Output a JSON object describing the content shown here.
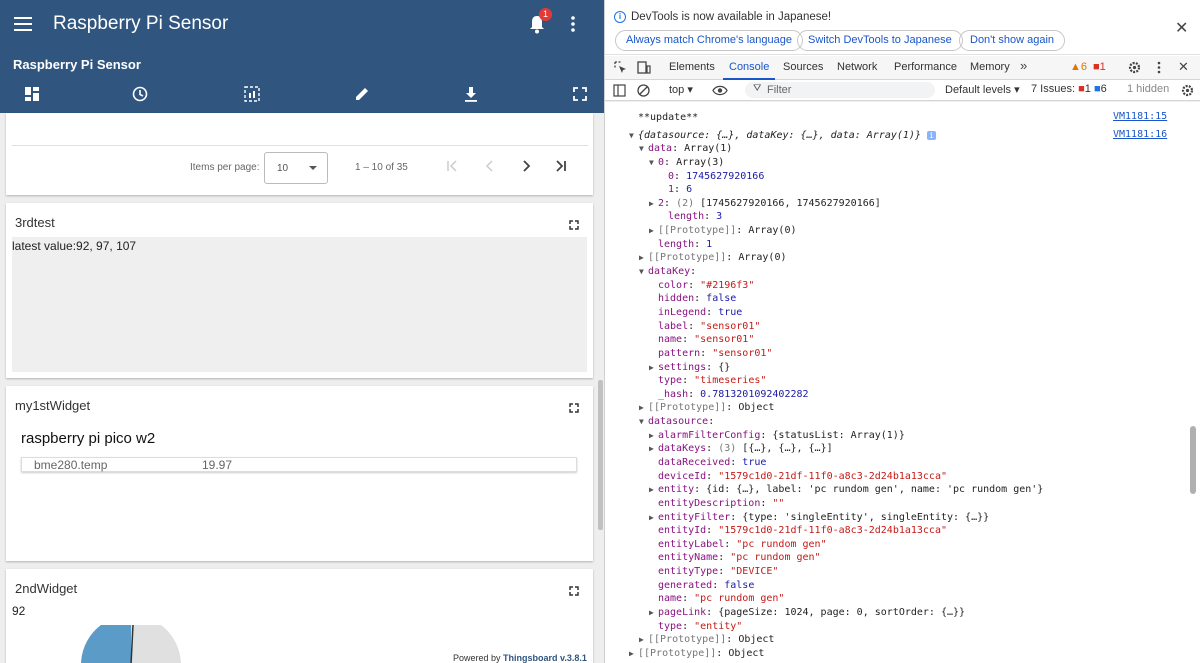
{
  "app": {
    "title": "Raspberry Pi Sensor",
    "notification_count": "1",
    "dashboard_title": "Raspberry Pi Sensor"
  },
  "toolbar_icons": [
    "dashboard-layout-icon",
    "history-icon",
    "widget-select-icon",
    "edit-icon",
    "download-icon",
    "fullscreen-icon"
  ],
  "pagination": {
    "items_per_page_label": "Items per page:",
    "items_per_page_value": "10",
    "range": "1 – 10 of 35"
  },
  "widgets": {
    "third": {
      "title": "3rdtest",
      "value_text": "latest value:92, 97, 107"
    },
    "first": {
      "title": "my1stWidget",
      "heading": "raspberry pi pico w2",
      "key": "bme280.temp",
      "value": "19.97"
    },
    "second": {
      "title": "2ndWidget",
      "value": "92"
    }
  },
  "footer": {
    "powered_by": "Powered by",
    "brand": "Thingsboard v.3.8.1"
  },
  "devtools": {
    "info_text": "DevTools is now available in Japanese!",
    "buttons": [
      "Always match Chrome's language",
      "Switch DevTools to Japanese",
      "Don't show again"
    ],
    "tabs": [
      "Elements",
      "Console",
      "Sources",
      "Network",
      "Performance",
      "Memory"
    ],
    "active_tab": "Console",
    "warn_count": "6",
    "error_count": "1",
    "context": "top",
    "filter_placeholder": "Filter",
    "levels": "Default levels",
    "issues_label": "7 Issues:",
    "issues_err": "1",
    "issues_info": "6",
    "hidden": "1 hidden",
    "source_links": [
      "VM1181:15",
      "VM1181:16"
    ]
  },
  "console_lines": [
    "**update**",
    "{datasource: {…}, dataKey: {…}, data: Array(1)}",
    "data: Array(1)",
    "0: Array(3)",
    "0: 1745627920166",
    "1: 6",
    "2: (2) [1745627920166, 1745627920166]",
    "length: 3",
    "[[Prototype]]: Array(0)",
    "length: 1",
    "[[Prototype]]: Array(0)",
    "dataKey:",
    "color: \"#2196f3\"",
    "hidden: false",
    "inLegend: true",
    "label: \"sensor01\"",
    "name: \"sensor01\"",
    "pattern: \"sensor01\"",
    "settings: {}",
    "type: \"timeseries\"",
    "_hash: 0.7813201092402282",
    "[[Prototype]]: Object",
    "datasource:",
    "alarmFilterConfig: {statusList: Array(1)}",
    "dataKeys: (3) [{…}, {…}, {…}]",
    "dataReceived: true",
    "deviceId: \"1579c1d0-21df-11f0-a8c3-2d24b1a13cca\"",
    "entity: {id: {…}, label: 'pc rundom gen', name: 'pc rundom gen'}",
    "entityDescription: \"\"",
    "entityFilter: {type: 'singleEntity', singleEntity: {…}}",
    "entityId: \"1579c1d0-21df-11f0-a8c3-2d24b1a13cca\"",
    "entityLabel: \"pc rundom gen\"",
    "entityName: \"pc rundom gen\"",
    "entityType: \"DEVICE\"",
    "generated: false",
    "name: \"pc rundom gen\"",
    "pageLink: {pageSize: 1024, page: 0, sortOrder: {…}}",
    "type: \"entity\"",
    "[[Prototype]]: Object",
    "[[Prototype]]: Object"
  ]
}
